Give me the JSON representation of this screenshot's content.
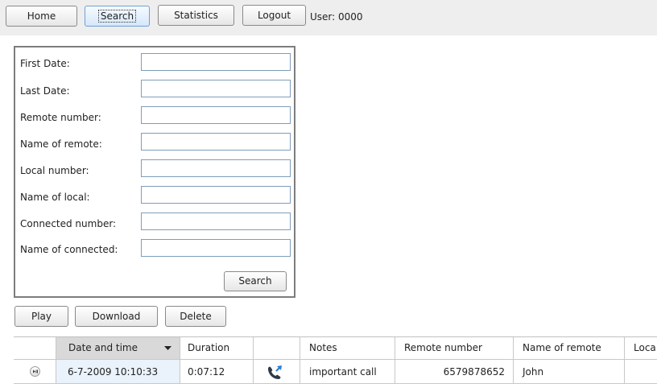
{
  "nav": {
    "home": "Home",
    "search": "Search",
    "statistics": "Statistics",
    "logout": "Logout",
    "user": "User: 0000"
  },
  "form": {
    "fields": [
      {
        "label": "First Date:",
        "value": ""
      },
      {
        "label": "Last Date:",
        "value": ""
      },
      {
        "label": "Remote number:",
        "value": ""
      },
      {
        "label": "Name of remote:",
        "value": ""
      },
      {
        "label": "Local number:",
        "value": ""
      },
      {
        "label": "Name of local:",
        "value": ""
      },
      {
        "label": "Connected number:",
        "value": ""
      },
      {
        "label": "Name of connected:",
        "value": ""
      }
    ],
    "submit": "Search"
  },
  "actions": {
    "play": "Play",
    "download": "Download",
    "delete": "Delete"
  },
  "table": {
    "columns": [
      "",
      "Date and time",
      "Duration",
      "",
      "Notes",
      "Remote number",
      "Name of remote",
      "Loca"
    ],
    "sorted_column": "Date and time",
    "rows": [
      {
        "date": "6-7-2009 10:10:33",
        "duration": "0:07:12",
        "icon": "outgoing-call-icon",
        "notes": "important call",
        "remote_number": "6579878652",
        "name_of_remote": "John",
        "local": ""
      }
    ]
  }
}
